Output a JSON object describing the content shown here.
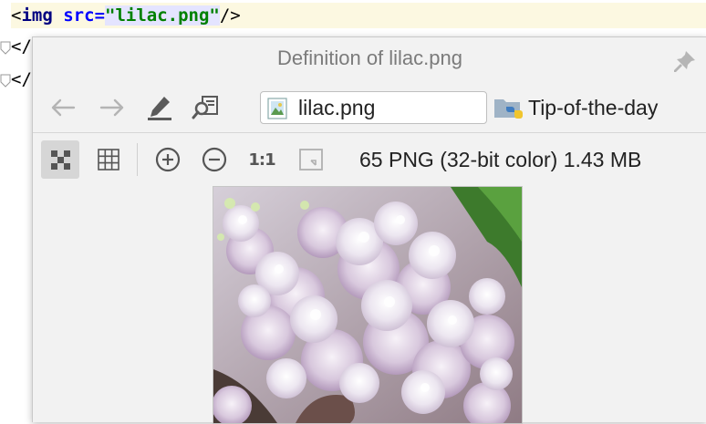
{
  "editor": {
    "line1": {
      "open": "<",
      "tag": "img",
      "attr": "src",
      "eq": "=",
      "value": "\"lilac.png\"",
      "close": "/>"
    },
    "line2": "</",
    "line3": "</"
  },
  "popup": {
    "title": "Definition of lilac.png",
    "file_name": "lilac.png",
    "project_name": "Tip-of-the-day",
    "zoom_actual_label": "1:1",
    "image_info": "65 PNG (32-bit color) 1.43 MB",
    "icons": {
      "pin": "pin-icon",
      "back": "back-arrow-icon",
      "forward": "forward-arrow-icon",
      "edit": "edit-pencil-icon",
      "find_usages": "find-usages-icon",
      "file": "image-file-icon",
      "project": "python-folder-icon",
      "chessboard": "chessboard-icon",
      "grid": "grid-icon",
      "zoom_in": "zoom-in-icon",
      "zoom_out": "zoom-out-icon",
      "fit": "fit-to-window-icon"
    },
    "colors": {
      "tag": "#000080",
      "attribute": "#0000ff",
      "string": "#008000",
      "line_highlight": "#fcf8e1"
    }
  }
}
